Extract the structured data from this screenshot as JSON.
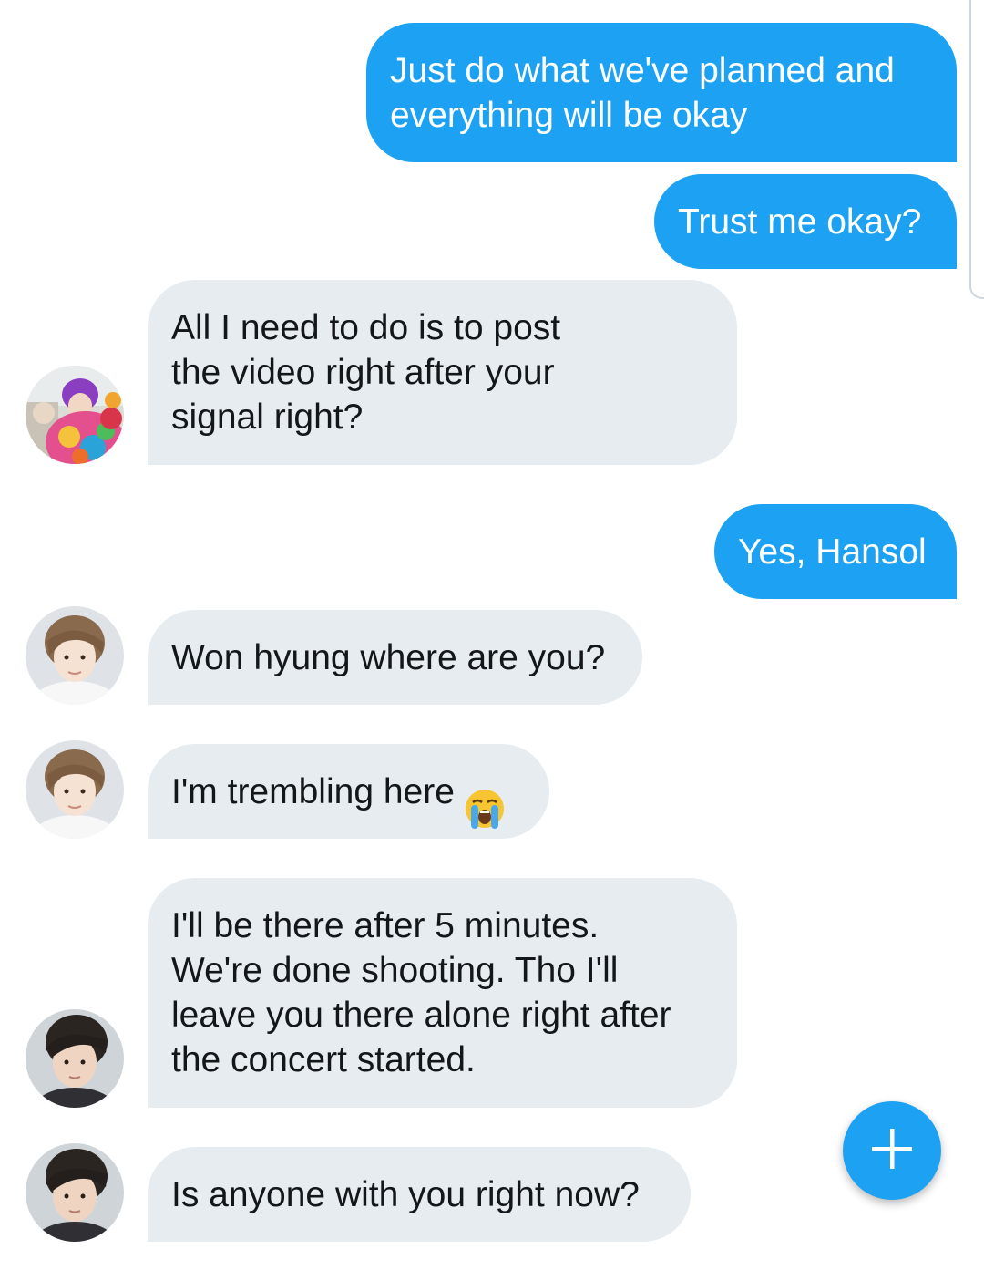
{
  "colors": {
    "sent_bubble": "#1da1f2",
    "received_bubble": "#e6ecf0",
    "fab": "#1da1f2"
  },
  "messages": [
    {
      "direction": "sent",
      "text": "Just do what we've planned and\neverything will be okay"
    },
    {
      "direction": "sent",
      "text": "Trust me okay?"
    },
    {
      "direction": "received",
      "avatar": "avatar-rainbow-hoodie",
      "text": "All I need to do is to post\nthe video right after your\nsignal right?"
    },
    {
      "direction": "sent",
      "text": "Yes, Hansol"
    },
    {
      "direction": "received",
      "avatar": "avatar-light-hair",
      "text": "Won hyung where are you?"
    },
    {
      "direction": "received",
      "avatar": "avatar-light-hair",
      "text": "I'm trembling here",
      "emoji": "loudly-crying-face-icon"
    },
    {
      "direction": "received",
      "avatar": "avatar-dark-hair",
      "text": "I'll be there after 5 minutes.\nWe're done shooting. Tho I'll\nleave you there alone right after\nthe concert started."
    },
    {
      "direction": "received",
      "avatar": "avatar-dark-hair",
      "text": "Is anyone with you right now?"
    }
  ],
  "fab": {
    "icon": "plus-icon"
  }
}
